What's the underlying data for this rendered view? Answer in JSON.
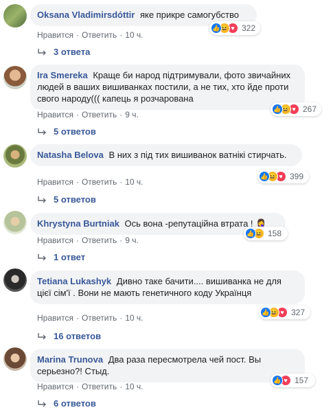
{
  "comments": [
    {
      "author": "Oksana Vladimirsdóttir",
      "text": "яке прикре самогубство",
      "like_label": "Нравится",
      "reply_label": "Ответить",
      "time": "10 ч.",
      "reactions": "322",
      "replies": "3 ответа"
    },
    {
      "author": "Ira Smereka",
      "text": "Краще би народ підтримували, фото звичайних людей в ваших вишиванках постили, а не тих, хто йде проти свого народу((( капець я розчарована",
      "like_label": "Нравится",
      "reply_label": "Ответить",
      "time": "9 ч.",
      "reactions": "267",
      "replies": "5 ответов"
    },
    {
      "author": "Natasha Belova",
      "text": "В них з під тих вишиванок ватнікі стирчать.",
      "like_label": "Нравится",
      "reply_label": "Ответить",
      "time": "10 ч.",
      "reactions": "399",
      "replies": "5 ответов"
    },
    {
      "author": "Khrystyna Burtniak",
      "text": "Ось вона -репутаційна втрата ! 🤦‍♀️",
      "like_label": "Нравится",
      "reply_label": "Ответить",
      "time": "9 ч.",
      "reactions": "158",
      "replies": "1 ответ"
    },
    {
      "author": "Tetiana Lukashyk",
      "text": "Дивно таке бачити.... вишиванка не для цієї сім'ї . Вони не мають генетичного коду Українця",
      "like_label": "Нравится",
      "reply_label": "Ответить",
      "time": "10 ч.",
      "reactions": "327",
      "replies": "16 ответов"
    },
    {
      "author": "Marina Trunova",
      "text": "Два раза пересмотрела чей пост. Вы серьезно?! Стыд.",
      "like_label": "Нравится",
      "reply_label": "Ответить",
      "time": "10 ч.",
      "reactions": "157",
      "replies": "6 ответов"
    }
  ],
  "colors": {
    "author": "#385898",
    "bubble": "#f2f3f5",
    "like": "#1877f2",
    "haha": "#f7b928",
    "love": "#f33e58"
  }
}
